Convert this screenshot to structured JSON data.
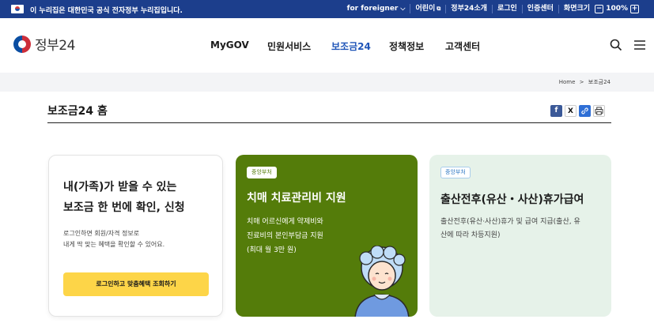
{
  "topbar": {
    "notice": "이 누리집은 대한민국 공식 전자정부 누리집입니다.",
    "for_foreigner": "for foreigner",
    "kids": "어린이",
    "intro": "정부24소개",
    "login": "로그인",
    "certificate": "인증센터",
    "zoom_label": "화면크기",
    "zoom_minus": "−",
    "zoom_value": "100%",
    "zoom_plus": "+"
  },
  "header": {
    "logo_text": "정부24",
    "nav": [
      "MyGOV",
      "민원서비스",
      "보조금24",
      "정책정보",
      "고객센터"
    ],
    "active_nav": "보조금24"
  },
  "breadcrumb": {
    "home": "Home",
    "separator": ">",
    "current": "보조금24"
  },
  "page": {
    "title": "보조금24 홈"
  },
  "share": {
    "facebook": "f",
    "x": "X",
    "link": "🔗",
    "print": "⎙"
  },
  "cards": {
    "login_card": {
      "title_line1": "내(가족)가 받을 수 있는",
      "title_line2": "보조금 한 번에 확인, 신청",
      "desc_line1": "로그인하면 회원/자격 정보로",
      "desc_line2": "내게 딱 맞는 혜택을 확인할 수 있어요.",
      "button": "로그인하고 맞춤혜택 조회하기"
    },
    "dementia_card": {
      "badge": "중앙부처",
      "title": "치매 치료관리비 지원",
      "desc_line1": "치매 어르신에게 약제비와",
      "desc_line2": "진료비의 본인부담금 지원",
      "desc_line3": "(최대 월 3만 원)",
      "bg_color": "#547c0a"
    },
    "childbirth_card": {
      "badge": "중앙부처",
      "title": "출산전후(유산・사산)휴가급여",
      "desc_line1": "출산전후(유산·사산)휴가 및 급여 지급(출산, 유",
      "desc_line2": "산에 따라 차등지원)",
      "bg_color": "#e6f2e9"
    }
  },
  "colors": {
    "topbar": "#1c3e8c",
    "active_nav": "#1f55b8",
    "button_yellow": "#fdd548"
  }
}
